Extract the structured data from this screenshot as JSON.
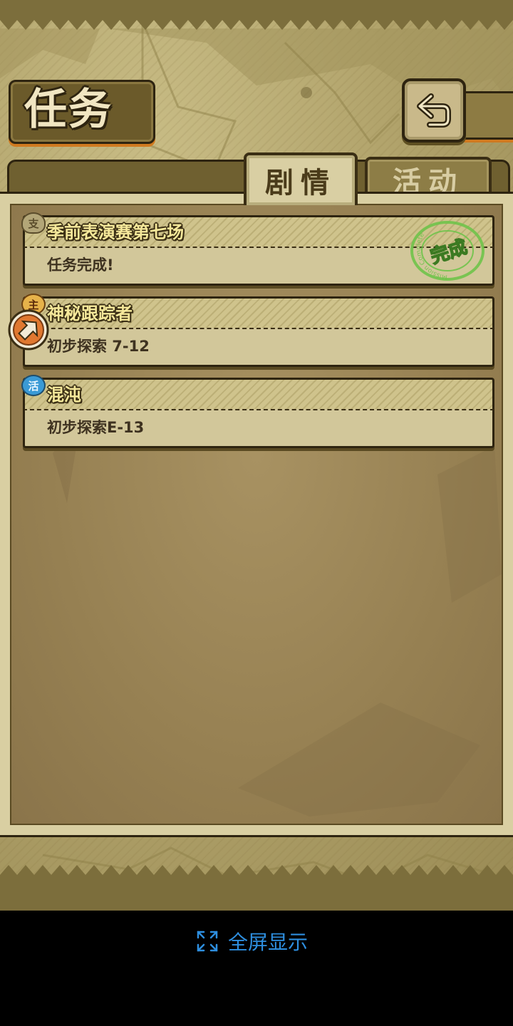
{
  "header": {
    "title": "任务",
    "back_icon": "back-arrow-icon"
  },
  "tabs": [
    {
      "label": "剧情",
      "active": true
    },
    {
      "label": "活动",
      "active": false
    }
  ],
  "quests": [
    {
      "badge": "支",
      "badge_color": "#b3a678",
      "title": "季前表演赛第七场",
      "description": "任务完成!",
      "completed": true
    },
    {
      "badge": "主",
      "badge_color": "#e6b24a",
      "title": "神秘跟踪者",
      "description": "初步探索 7-12",
      "completed": false,
      "selected": true
    },
    {
      "badge": "活",
      "badge_color": "#3a9ad6",
      "title": "混沌",
      "description": "初步探索E-13",
      "completed": false
    }
  ],
  "stamp": {
    "text": "完成",
    "ring_text": "Mission Complete"
  },
  "footer": {
    "fullscreen_label": "全屏显示",
    "fullscreen_icon": "expand-icon"
  },
  "colors": {
    "accent_orange": "#d07a20",
    "stamp_green": "#6fc34a",
    "fullscreen_blue": "#2e8fe0"
  }
}
